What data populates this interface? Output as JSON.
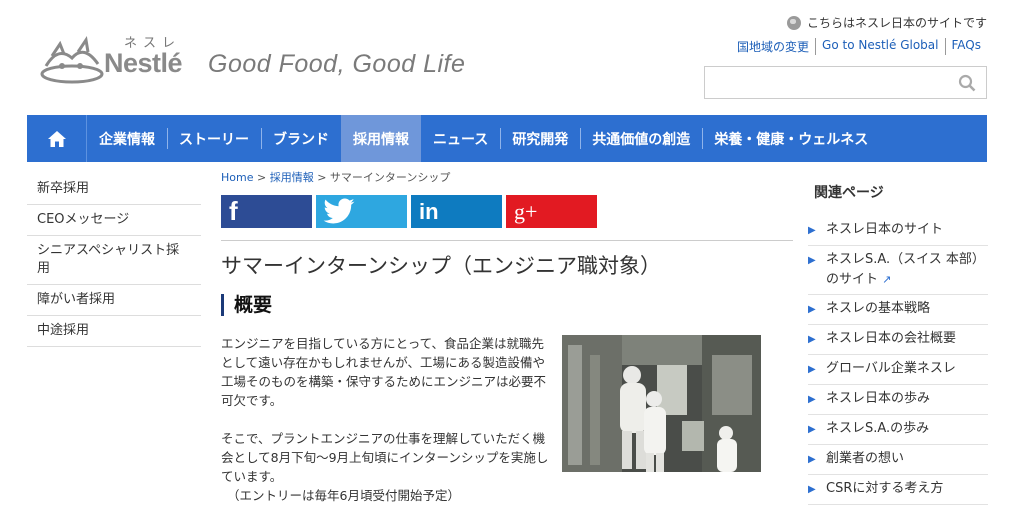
{
  "header": {
    "logo_kana": "ネスレ",
    "logo_word": "Nestlé",
    "tagline": "Good Food, Good Life",
    "site_note": "こちらはネスレ日本のサイトです",
    "links": [
      "国地域の変更",
      "Go to Nestlé Global",
      "FAQs"
    ],
    "search_placeholder": ""
  },
  "nav": {
    "items": [
      "企業情報",
      "ストーリー",
      "ブランド",
      "採用情報",
      "ニュース",
      "研究開発",
      "共通価値の創造",
      "栄養・健康・ウェルネス"
    ],
    "active": "採用情報"
  },
  "leftnav": [
    "新卒採用",
    "CEOメッセージ",
    "シニアスペシャリスト採用",
    "障がい者採用",
    "中途採用"
  ],
  "breadcrumb": {
    "home": "Home",
    "sep": ">",
    "parent": "採用情報",
    "current": "サマーインターンシップ"
  },
  "share": {
    "facebook": "f",
    "linkedin": "in",
    "google": "g+"
  },
  "main": {
    "title": "サマーインターンシップ（エンジニア職対象）",
    "heading": "概要",
    "para1": "エンジニアを目指している方にとって、食品企業は就職先として遠い存在かもしれませんが、工場にある製造設備や工場そのものを構築・保守するためにエンジニアは必要不可欠です。",
    "para2": "そこで、プラントエンジニアの仕事を理解していただく機会として8月下旬〜9月上旬頃にインターンシップを実施しています。",
    "para3": "（エントリーは毎年6月頃受付開始予定）"
  },
  "related": {
    "title": "関連ページ",
    "items": [
      "ネスレ日本のサイト",
      "ネスレS.A.（スイス 本部）のサイト",
      "ネスレの基本戦略",
      "ネスレ日本の会社概要",
      "グローバル企業ネスレ",
      "ネスレ日本の歩み",
      "ネスレS.A.の歩み",
      "創業者の想い",
      "CSRに対する考え方"
    ]
  },
  "colors": {
    "nav": "#2d6fd0",
    "nav_active": "#6f97da",
    "facebook": "#2d4c95",
    "twitter": "#2ea7e0",
    "linkedin": "#0e7bc0",
    "google": "#e21a22"
  }
}
